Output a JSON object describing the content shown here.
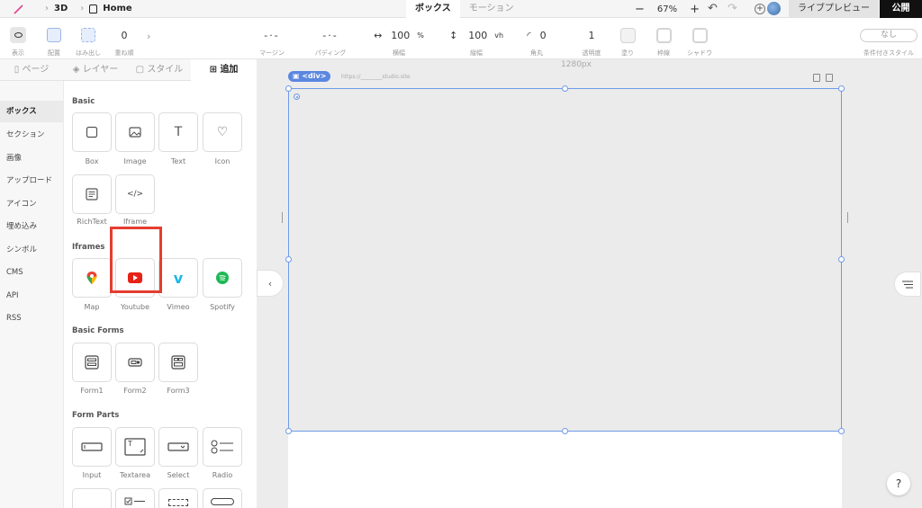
{
  "topbar": {
    "breadcrumb": {
      "project": "3D",
      "page": "Home"
    },
    "tabs": [
      "ボックス",
      "モーション"
    ],
    "zoom": {
      "minus": "−",
      "value": "67%",
      "plus": "+"
    },
    "live_preview": "ライブプレビュー",
    "publish": "公開"
  },
  "propbar": {
    "display": "表示",
    "layout": "配置",
    "overflow": "はみ出し",
    "stack_value": "0",
    "stack_label": "重ね順",
    "margin_label": "マージン",
    "padding_label": "パディング",
    "width_value": "100",
    "width_unit": "%",
    "width_label": "横幅",
    "height_value": "100",
    "height_unit": "vh",
    "height_label": "縦幅",
    "radius_value": "0",
    "radius_label": "角丸",
    "opacity_value": "1",
    "opacity_label": "透明度",
    "fill_label": "塗り",
    "border_label": "枠線",
    "shadow_label": "シャドウ",
    "conditional_value": "なし",
    "conditional_label": "条件付きスタイル"
  },
  "panel": {
    "tabs": [
      "ページ",
      "レイヤー",
      "スタイル",
      "追加"
    ],
    "nav": [
      "ボックス",
      "セクション",
      "画像",
      "アップロード",
      "アイコン",
      "埋め込み",
      "シンボル",
      "CMS",
      "API",
      "RSS"
    ],
    "sections": {
      "basic": {
        "title": "Basic",
        "items": [
          "Box",
          "Image",
          "Text",
          "Icon",
          "RichText",
          "Iframe"
        ]
      },
      "iframes": {
        "title": "Iframes",
        "items": [
          "Map",
          "Youtube",
          "Vimeo",
          "Spotify"
        ]
      },
      "forms": {
        "title": "Basic Forms",
        "items": [
          "Form1",
          "Form2",
          "Form3"
        ]
      },
      "parts": {
        "title": "Form Parts",
        "items": [
          "Input",
          "Textarea",
          "Select",
          "Radio"
        ]
      }
    }
  },
  "canvas": {
    "width_label": "1280px",
    "element_tag": "<div>",
    "url": "https://________studio.site"
  },
  "colors": {
    "accent": "#6f9be8",
    "highlight": "#e53d2f",
    "chip": "#5b87e0"
  },
  "help": "?"
}
